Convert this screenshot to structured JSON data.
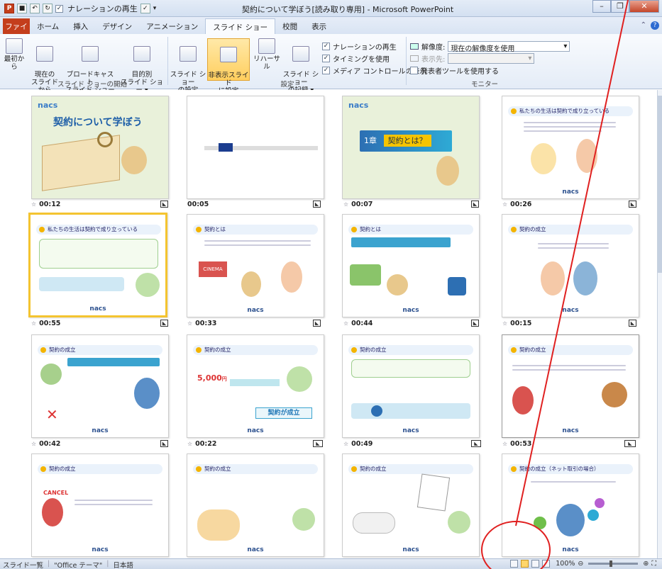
{
  "app": {
    "window_title": "契約について学ぼう[読み取り専用] - Microsoft PowerPoint",
    "qat_narration": "ナレーションの再生"
  },
  "tabs": [
    "ファイル",
    "ホーム",
    "挿入",
    "デザイン",
    "アニメーション",
    "スライド ショー",
    "校閲",
    "表示"
  ],
  "active_tab": "スライド ショー",
  "ribbon": {
    "start_group_label": "スライド ショーの開始",
    "buttons_start": [
      "最初から",
      "現在の\nスライドから",
      "ブロードキャスト\nスライド ショー",
      "目的別\nスライド ショー ▾"
    ],
    "buttons_setup": [
      "スライド ショー\nの設定",
      "非表示スライド\nに設定",
      "リハーサル",
      "スライド ショー\nの記録 ▾"
    ],
    "setup_group_label": "設定",
    "checkboxes": [
      {
        "label": "ナレーションの再生",
        "checked": true
      },
      {
        "label": "タイミングを使用",
        "checked": true
      },
      {
        "label": "メディア コントロールの表示",
        "checked": true
      }
    ],
    "monitor": {
      "resolution_label": "解像度:",
      "resolution_value": "現在の解像度を使用",
      "display_label": "表示先:",
      "presenter_label": "発表者ツールを使用する",
      "group_label": "モニター"
    }
  },
  "slides": [
    {
      "time": "00:12",
      "title": "契約について学ぼう",
      "type": "cover"
    },
    {
      "time": "00:05",
      "title": "",
      "type": "blank"
    },
    {
      "time": "00:07",
      "title": "契約とは？",
      "chapter": "1章",
      "type": "chapter"
    },
    {
      "time": "00:26",
      "title": "私たちの生活は契約で成り立っている",
      "type": "content"
    },
    {
      "time": "00:55",
      "title": "私たちの生活は契約で成り立っている",
      "type": "content",
      "selected": true
    },
    {
      "time": "00:33",
      "title": "契約とは",
      "type": "content"
    },
    {
      "time": "00:44",
      "title": "契約とは",
      "type": "content"
    },
    {
      "time": "00:15",
      "title": "契約の成立",
      "type": "content"
    },
    {
      "time": "00:42",
      "title": "契約の成立",
      "type": "content"
    },
    {
      "time": "00:22",
      "title": "契約の成立",
      "type": "content",
      "badge": "契約が成立"
    },
    {
      "time": "00:49",
      "title": "契約の成立",
      "type": "content"
    },
    {
      "time": "00:53",
      "title": "契約の成立",
      "type": "content"
    },
    {
      "time": "",
      "title": "契約の成立",
      "type": "content"
    },
    {
      "time": "",
      "title": "契約の成立",
      "type": "content"
    },
    {
      "time": "",
      "title": "契約の成立",
      "type": "content"
    },
    {
      "time": "",
      "title": "契約の成立（ネット取引の場合）",
      "type": "content"
    }
  ],
  "brand": "nacs",
  "status": {
    "view": "スライド一覧",
    "theme": "\"Office テーマ\"",
    "language": "日本語",
    "zoom": "100%"
  },
  "colors": {
    "file_tab": "#c43e1c",
    "annotation": "#e02020",
    "selection": "#f4c430"
  }
}
